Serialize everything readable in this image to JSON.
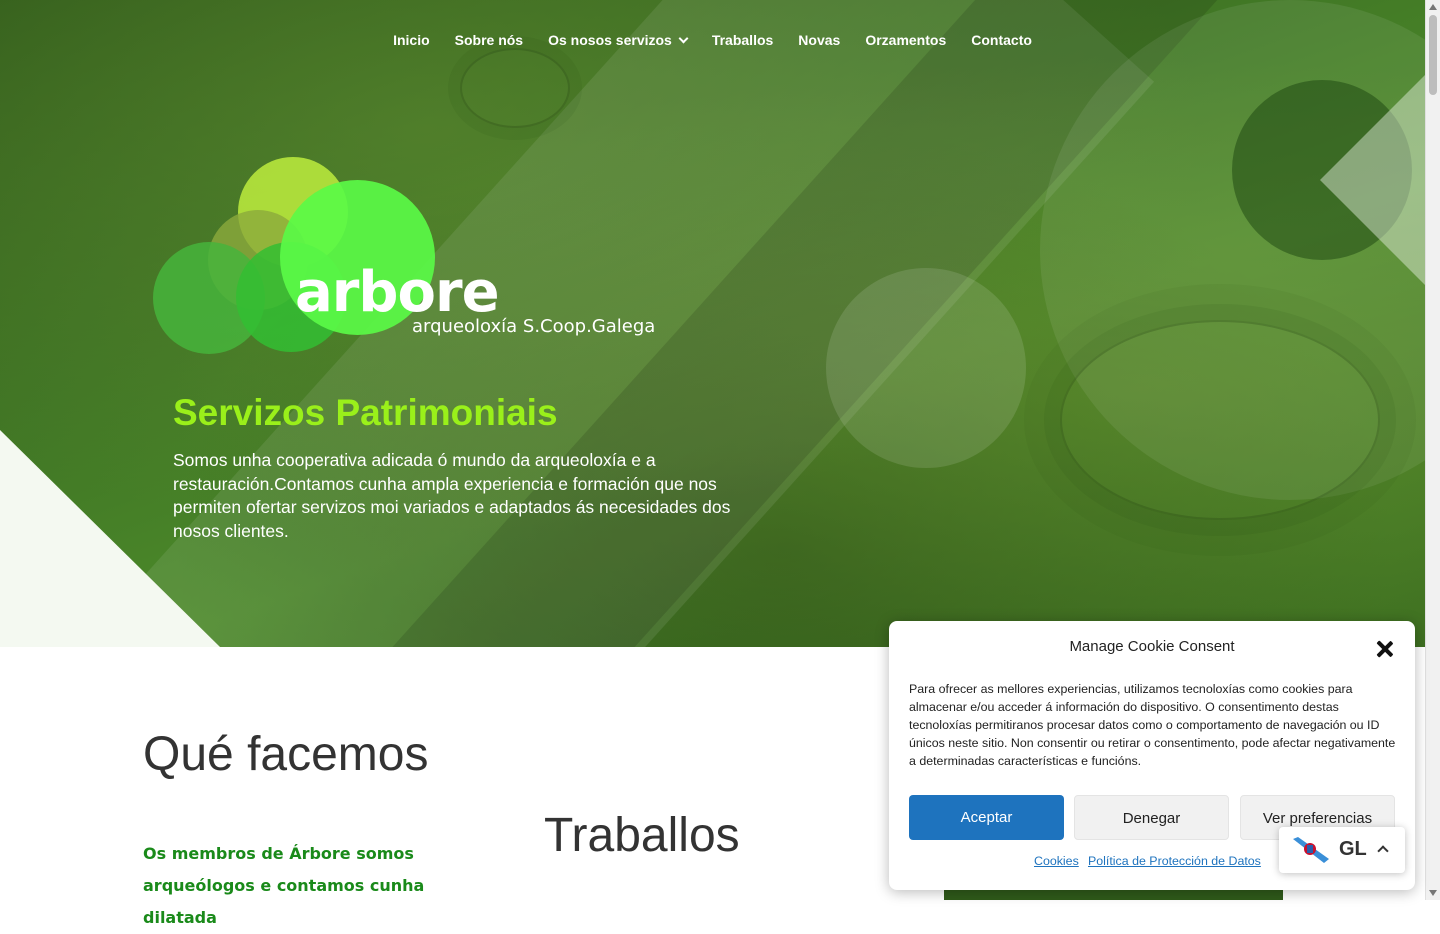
{
  "nav": {
    "items": [
      {
        "label": "Inicio"
      },
      {
        "label": "Sobre nós"
      },
      {
        "label": "Os nosos servizos"
      },
      {
        "label": "Traballos"
      },
      {
        "label": "Novas"
      },
      {
        "label": "Orzamentos"
      },
      {
        "label": "Contacto"
      }
    ]
  },
  "logo": {
    "word": "arbore",
    "subtitle": "arqueoloxía S.Coop.Galega",
    "colors": {
      "lime": "#b4e43c",
      "bright": "#4cf03c",
      "mid": "#3cb43c",
      "olive": "#8cb43c"
    }
  },
  "hero": {
    "title": "Servizos Patrimoniais",
    "text": "Somos unha cooperativa adicada ó mundo da arqueoloxía e a restauración.Contamos cunha ampla experiencia e formación que nos permiten ofertar servizos moi variados e adaptados ás necesidades dos nosos clientes."
  },
  "sections": {
    "what_title": "Qué facemos",
    "what_text": "Os membros de Árbore somos arqueólogos e contamos cunha dilatada",
    "works_title": "Traballos"
  },
  "cookie": {
    "title": "Manage Cookie Consent",
    "text": "Para ofrecer as mellores experiencias, utilizamos tecnoloxías como cookies para almacenar e/ou acceder á información do dispositivo. O consentimento destas tecnoloxías permitiranos procesar datos como o comportamento de navegación ou ID únicos neste sitio. Non consentir ou retirar o consentimento, pode afectar negativamente a determinadas características e funcións.",
    "accept": "Aceptar",
    "deny": "Denegar",
    "preferences": "Ver preferencias",
    "link_cookies": "Cookies",
    "link_privacy": "Política de Protección de Datos"
  },
  "language": {
    "code": "GL",
    "icon": "galician-flag-icon"
  },
  "colors": {
    "accent_green": "#9af01a",
    "button_blue": "#1e73be",
    "text_green": "#1a8a1a"
  }
}
